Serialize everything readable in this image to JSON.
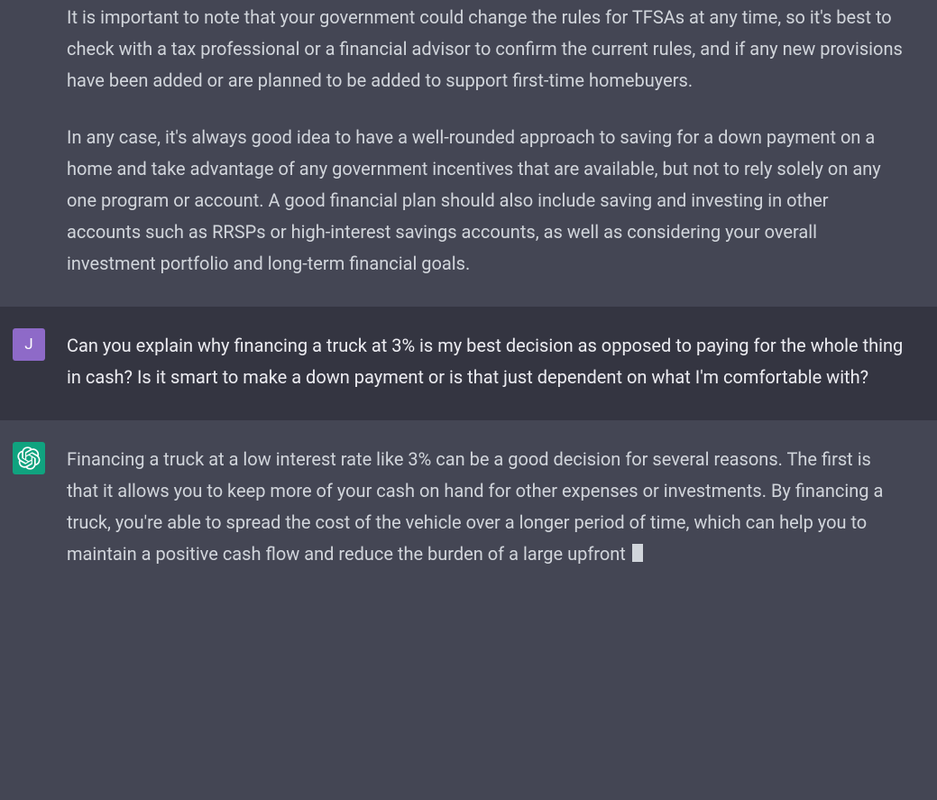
{
  "messages": {
    "m0": {
      "role": "assistant",
      "p1": "It is important to note that your government could change the rules for TFSAs at any time, so it's best to check with a tax professional or a financial advisor to confirm the current rules, and if any new provisions have been added or are planned to be added to support first-time homebuyers.",
      "p2": "In any case, it's always good idea to have a well-rounded approach to saving for a down payment on a home and take advantage of any government incentives that are available, but not to rely solely on any one program or account. A good financial plan should also include saving and investing in other accounts such as RRSPs or high-interest savings accounts, as well as considering your overall investment portfolio and long-term financial goals."
    },
    "m1": {
      "role": "user",
      "avatar_initial": "J",
      "text": "Can you explain why financing a truck at 3% is my best decision as opposed to paying for the whole thing in cash? Is it smart to make a down payment or is that just dependent on what I'm comfortable with?"
    },
    "m2": {
      "role": "assistant",
      "text": "Financing a truck at a low interest rate like 3% can be a good decision for several reasons. The first is that it allows you to keep more of your cash on hand for other expenses or investments. By financing a truck, you're able to spread the cost of the vehicle over a longer period of time, which can help you to maintain a positive cash flow and reduce the burden of a large upfront "
    }
  }
}
